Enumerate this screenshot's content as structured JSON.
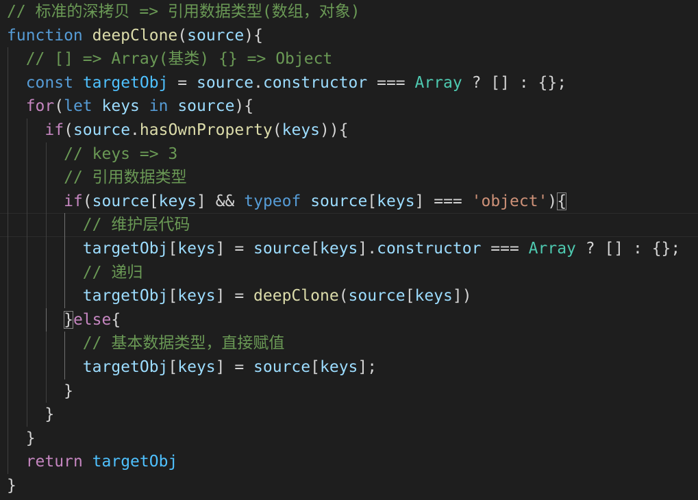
{
  "code": {
    "lines": [
      {
        "tokens": [
          {
            "t": "// 标准的深拷贝 => 引用数据类型(数组，对象)",
            "c": "cm"
          }
        ]
      },
      {
        "tokens": [
          {
            "t": "function",
            "c": "kw"
          },
          {
            "t": " ",
            "c": "pl"
          },
          {
            "t": "deepClone",
            "c": "fn"
          },
          {
            "t": "(",
            "c": "pl"
          },
          {
            "t": "source",
            "c": "var"
          },
          {
            "t": "){",
            "c": "pl"
          }
        ]
      },
      {
        "tokens": [
          {
            "t": "  ",
            "c": "pl"
          },
          {
            "t": "// [] => Array(基类) {} => Object",
            "c": "cm"
          }
        ]
      },
      {
        "tokens": [
          {
            "t": "  ",
            "c": "pl"
          },
          {
            "t": "const",
            "c": "kw"
          },
          {
            "t": " ",
            "c": "pl"
          },
          {
            "t": "targetObj",
            "c": "cst"
          },
          {
            "t": " = ",
            "c": "pl"
          },
          {
            "t": "source",
            "c": "var"
          },
          {
            "t": ".",
            "c": "pl"
          },
          {
            "t": "constructor",
            "c": "var"
          },
          {
            "t": " === ",
            "c": "pl"
          },
          {
            "t": "Array",
            "c": "typ"
          },
          {
            "t": " ? [] : {};",
            "c": "pl"
          }
        ]
      },
      {
        "tokens": [
          {
            "t": "  ",
            "c": "pl"
          },
          {
            "t": "for",
            "c": "ctl"
          },
          {
            "t": "(",
            "c": "pl"
          },
          {
            "t": "let",
            "c": "kw"
          },
          {
            "t": " ",
            "c": "pl"
          },
          {
            "t": "keys",
            "c": "var"
          },
          {
            "t": " ",
            "c": "pl"
          },
          {
            "t": "in",
            "c": "kw"
          },
          {
            "t": " ",
            "c": "pl"
          },
          {
            "t": "source",
            "c": "var"
          },
          {
            "t": "){",
            "c": "pl"
          }
        ]
      },
      {
        "tokens": [
          {
            "t": "    ",
            "c": "pl"
          },
          {
            "t": "if",
            "c": "ctl"
          },
          {
            "t": "(",
            "c": "pl"
          },
          {
            "t": "source",
            "c": "var"
          },
          {
            "t": ".",
            "c": "pl"
          },
          {
            "t": "hasOwnProperty",
            "c": "fn"
          },
          {
            "t": "(",
            "c": "pl"
          },
          {
            "t": "keys",
            "c": "var"
          },
          {
            "t": ")){",
            "c": "pl"
          }
        ]
      },
      {
        "tokens": [
          {
            "t": "      ",
            "c": "pl"
          },
          {
            "t": "// keys => 3",
            "c": "cm"
          }
        ]
      },
      {
        "tokens": [
          {
            "t": "      ",
            "c": "pl"
          },
          {
            "t": "// 引用数据类型",
            "c": "cm"
          }
        ]
      },
      {
        "tokens": [
          {
            "t": "      ",
            "c": "pl"
          },
          {
            "t": "if",
            "c": "ctl"
          },
          {
            "t": "(",
            "c": "pl"
          },
          {
            "t": "source",
            "c": "var"
          },
          {
            "t": "[",
            "c": "pl"
          },
          {
            "t": "keys",
            "c": "var"
          },
          {
            "t": "] && ",
            "c": "pl"
          },
          {
            "t": "typeof",
            "c": "kw"
          },
          {
            "t": " ",
            "c": "pl"
          },
          {
            "t": "source",
            "c": "var"
          },
          {
            "t": "[",
            "c": "pl"
          },
          {
            "t": "keys",
            "c": "var"
          },
          {
            "t": "] === ",
            "c": "pl"
          },
          {
            "t": "'object'",
            "c": "str"
          },
          {
            "t": ")",
            "c": "pl"
          },
          {
            "t": "{",
            "c": "pl",
            "m": true
          }
        ]
      },
      {
        "tokens": [
          {
            "t": "        ",
            "c": "pl"
          },
          {
            "t": "// 维护层代码",
            "c": "cm"
          }
        ]
      },
      {
        "tokens": [
          {
            "t": "        ",
            "c": "pl"
          },
          {
            "t": "targetObj",
            "c": "var"
          },
          {
            "t": "[",
            "c": "pl"
          },
          {
            "t": "keys",
            "c": "var"
          },
          {
            "t": "] = ",
            "c": "pl"
          },
          {
            "t": "source",
            "c": "var"
          },
          {
            "t": "[",
            "c": "pl"
          },
          {
            "t": "keys",
            "c": "var"
          },
          {
            "t": "].",
            "c": "pl"
          },
          {
            "t": "constructor",
            "c": "var"
          },
          {
            "t": " === ",
            "c": "pl"
          },
          {
            "t": "Array",
            "c": "typ"
          },
          {
            "t": " ? [] : {};",
            "c": "pl"
          }
        ]
      },
      {
        "tokens": [
          {
            "t": "        ",
            "c": "pl"
          },
          {
            "t": "// 递归",
            "c": "cm"
          }
        ]
      },
      {
        "tokens": [
          {
            "t": "        ",
            "c": "pl"
          },
          {
            "t": "targetObj",
            "c": "var"
          },
          {
            "t": "[",
            "c": "pl"
          },
          {
            "t": "keys",
            "c": "var"
          },
          {
            "t": "] = ",
            "c": "pl"
          },
          {
            "t": "deepClone",
            "c": "fn"
          },
          {
            "t": "(",
            "c": "pl"
          },
          {
            "t": "source",
            "c": "var"
          },
          {
            "t": "[",
            "c": "pl"
          },
          {
            "t": "keys",
            "c": "var"
          },
          {
            "t": "])",
            "c": "pl"
          }
        ]
      },
      {
        "tokens": [
          {
            "t": "      ",
            "c": "pl"
          },
          {
            "t": "}",
            "c": "pl",
            "m": true
          },
          {
            "t": "else",
            "c": "ctl"
          },
          {
            "t": "{",
            "c": "pl"
          }
        ]
      },
      {
        "tokens": [
          {
            "t": "        ",
            "c": "pl"
          },
          {
            "t": "// 基本数据类型，直接赋值",
            "c": "cm"
          }
        ]
      },
      {
        "tokens": [
          {
            "t": "        ",
            "c": "pl"
          },
          {
            "t": "targetObj",
            "c": "var"
          },
          {
            "t": "[",
            "c": "pl"
          },
          {
            "t": "keys",
            "c": "var"
          },
          {
            "t": "] = ",
            "c": "pl"
          },
          {
            "t": "source",
            "c": "var"
          },
          {
            "t": "[",
            "c": "pl"
          },
          {
            "t": "keys",
            "c": "var"
          },
          {
            "t": "];",
            "c": "pl"
          }
        ]
      },
      {
        "tokens": [
          {
            "t": "      ",
            "c": "pl"
          },
          {
            "t": "}",
            "c": "pl"
          }
        ]
      },
      {
        "tokens": [
          {
            "t": "    ",
            "c": "pl"
          },
          {
            "t": "}",
            "c": "pl"
          }
        ]
      },
      {
        "tokens": [
          {
            "t": "  ",
            "c": "pl"
          },
          {
            "t": "}",
            "c": "pl"
          }
        ]
      },
      {
        "tokens": [
          {
            "t": "  ",
            "c": "pl"
          },
          {
            "t": "return",
            "c": "ctl"
          },
          {
            "t": " ",
            "c": "pl"
          },
          {
            "t": "targetObj",
            "c": "cst"
          }
        ]
      },
      {
        "tokens": [
          {
            "t": "}",
            "c": "pl"
          }
        ]
      }
    ]
  },
  "theme": {
    "background": "#1e1e1e",
    "comment": "#6a9955",
    "keyword": "#569cd6",
    "control": "#c586c0",
    "function": "#dcdcaa",
    "variable": "#9cdcfe",
    "constant": "#4fc1ff",
    "type": "#4ec9b0",
    "string": "#ce9178",
    "plain": "#d4d4d4"
  }
}
